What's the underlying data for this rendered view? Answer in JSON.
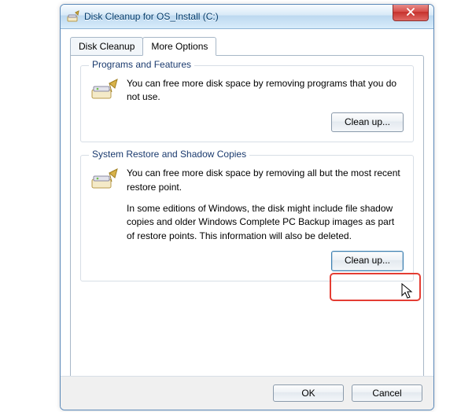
{
  "window": {
    "title": "Disk Cleanup for OS_Install (C:)",
    "close_label": "Close"
  },
  "tabs": {
    "disk_cleanup": "Disk Cleanup",
    "more_options": "More Options"
  },
  "groups": {
    "programs": {
      "title": "Programs and Features",
      "desc": "You can free more disk space by removing programs that you do not use.",
      "button": "Clean up..."
    },
    "restore": {
      "title": "System Restore and Shadow Copies",
      "desc1": "You can free more disk space by removing all but the most recent restore point.",
      "desc2": "In some editions of Windows, the disk might include file shadow copies and older Windows Complete PC Backup images as part of restore points. This information will also be deleted.",
      "button": "Clean up..."
    }
  },
  "buttons": {
    "ok": "OK",
    "cancel": "Cancel"
  },
  "colors": {
    "highlight": "#e43d33",
    "title_text": "#003a6a"
  },
  "icons": {
    "app": "disk-cleanup-icon",
    "close": "close-icon",
    "drive": "drive-brush-icon",
    "cursor": "mouse-cursor-icon"
  }
}
